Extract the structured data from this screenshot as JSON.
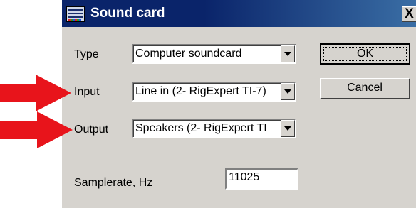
{
  "dialog": {
    "title": "Sound card",
    "close_symbol": "X"
  },
  "fields": {
    "type": {
      "label": "Type",
      "value": "Computer soundcard"
    },
    "input": {
      "label": "Input",
      "value": "Line in (2- RigExpert TI-7)"
    },
    "output": {
      "label": "Output",
      "value": "Speakers (2- RigExpert TI"
    },
    "samplerate": {
      "label": "Samplerate, Hz",
      "value": "11025"
    }
  },
  "buttons": {
    "ok": "OK",
    "cancel": "Cancel"
  },
  "colors": {
    "arrow": "#e8141b",
    "titlebar": "#0a246a",
    "dialog_bg": "#d6d3ce"
  }
}
